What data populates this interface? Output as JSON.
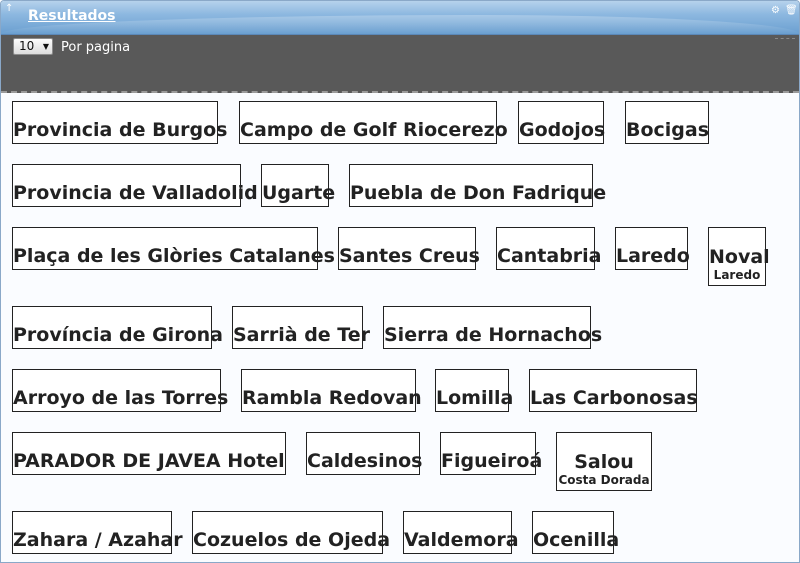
{
  "portlet": {
    "title": "Resultados",
    "pin_icon": "arrow-up-icon",
    "settings_icon": "gear-icon",
    "delete_icon": "trash-icon"
  },
  "pagination": {
    "per_page_value": "10",
    "per_page_label": "Por pagina"
  },
  "results": [
    {
      "name": "Provincia de Burgos"
    },
    {
      "name": "Campo de Golf Riocerezo"
    },
    {
      "name": "Godojos"
    },
    {
      "name": "Bocigas"
    },
    {
      "name": "Provincia de Valladolid"
    },
    {
      "name": "Ugarte"
    },
    {
      "name": "Puebla de Don Fadrique"
    },
    {
      "name": "Plaça de les Glòries Catalanes"
    },
    {
      "name": "Santes Creus"
    },
    {
      "name": "Cantabria"
    },
    {
      "name": "Laredo"
    },
    {
      "name": "Noval",
      "sub": "Laredo"
    },
    {
      "name": "Província de Girona"
    },
    {
      "name": "Sarrià de Ter"
    },
    {
      "name": "Sierra de Hornachos"
    },
    {
      "name": "Arroyo de las Torres"
    },
    {
      "name": "Rambla Redovan"
    },
    {
      "name": "Lomilla"
    },
    {
      "name": "Las Carbonosas"
    },
    {
      "name": "PARADOR DE JAVEA Hotel"
    },
    {
      "name": "Caldesinos"
    },
    {
      "name": "Figueiroá"
    },
    {
      "name": "Salou",
      "sub": "Costa Dorada"
    },
    {
      "name": "Zahara / Azahar"
    },
    {
      "name": "Cozuelos de Ojeda"
    },
    {
      "name": "Valdemora"
    },
    {
      "name": "Ocenilla"
    }
  ]
}
